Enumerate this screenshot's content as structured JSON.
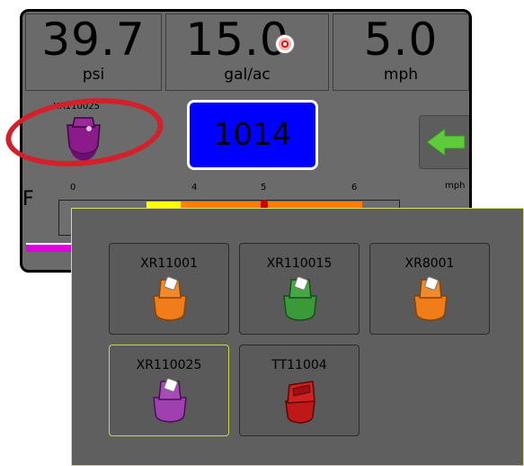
{
  "readouts": [
    {
      "value": "39.7",
      "unit": "psi"
    },
    {
      "value": "15.0",
      "unit": "gal/ac"
    },
    {
      "value": "5.0",
      "unit": "mph"
    }
  ],
  "current_tip": {
    "label": "XR110025",
    "color": "#8b1a8b"
  },
  "value_box": {
    "value": "1014",
    "color": "#0000ff"
  },
  "bar": {
    "side_letter": "F",
    "scale": [
      "0",
      "4",
      "5",
      "6"
    ],
    "unit": "mph"
  },
  "popup": {
    "nozzles": [
      {
        "label": "XR11001",
        "color": "#f07d1a"
      },
      {
        "label": "XR110015",
        "color": "#3a9a3a"
      },
      {
        "label": "XR8001",
        "color": "#f07d1a"
      },
      {
        "label": "XR110025",
        "color": "#a040b0",
        "selected": true
      },
      {
        "label": "TT11004",
        "color": "#c01818"
      }
    ]
  },
  "accent": {
    "highlight": "#d4202a",
    "selected_border": "#c8d648",
    "back_arrow": "#5ecb3a"
  }
}
